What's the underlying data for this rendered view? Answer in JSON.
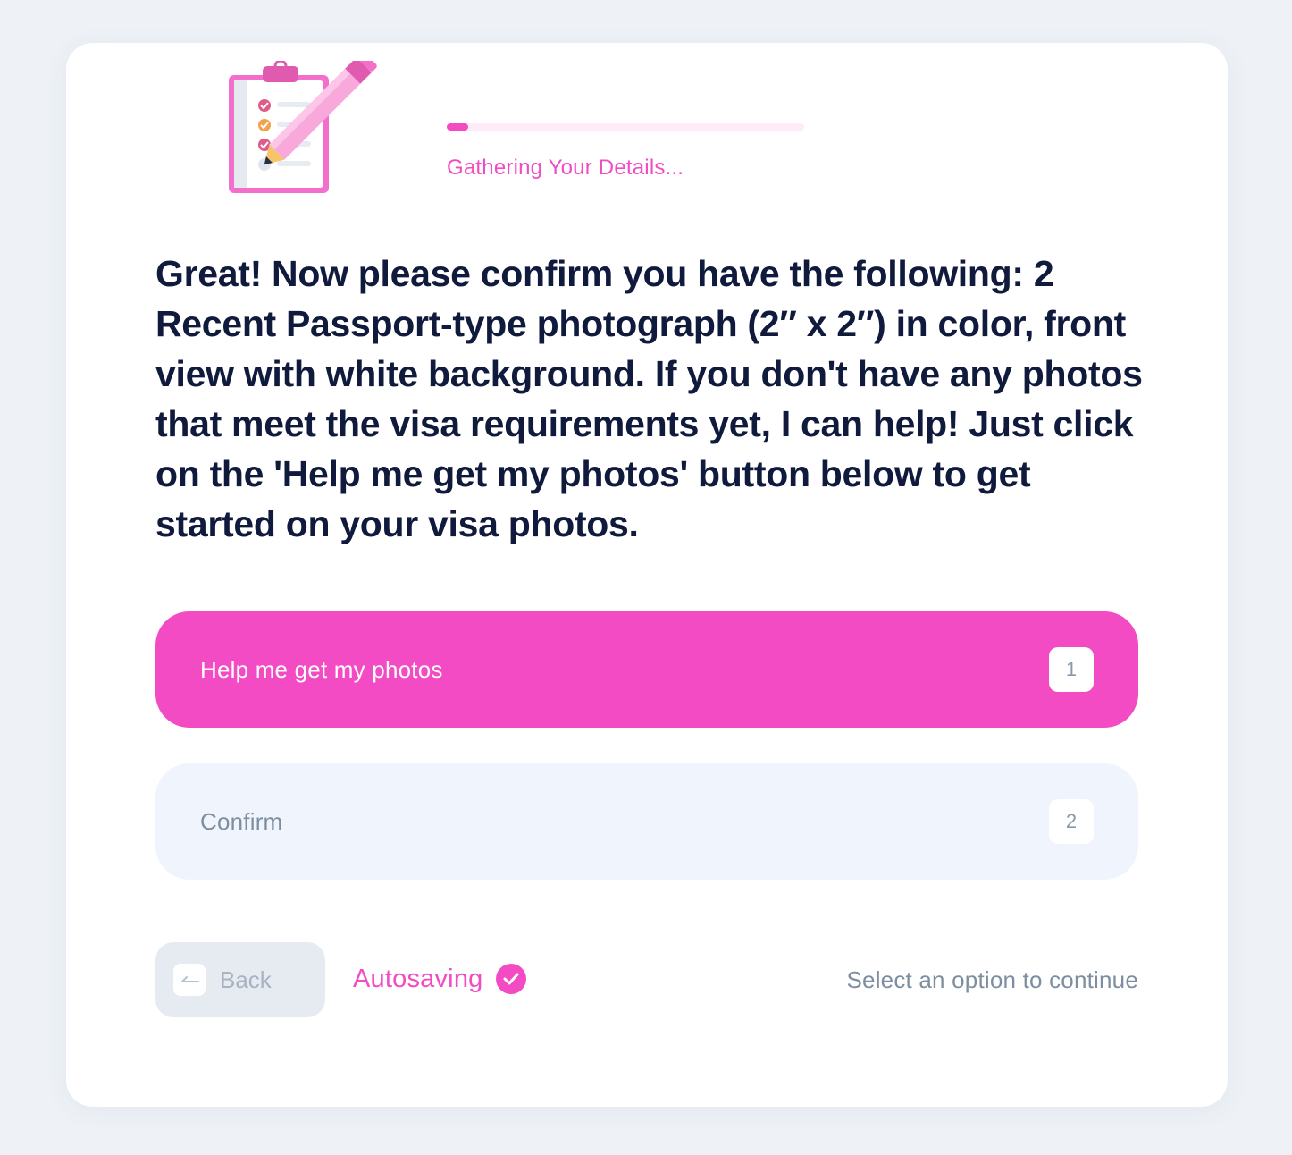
{
  "header": {
    "progress_label": "Gathering Your Details...",
    "progress_fraction": 0.06,
    "illustration_icon": "clipboard-pencil-icon"
  },
  "question": {
    "text": "Great! Now please confirm you have the following: 2 Recent Passport-type photograph (2″ x 2″) in color, front view with white background. If you don't have any photos that meet the visa requirements yet, I can help! Just click on the 'Help me get my photos' button below to get started on your visa photos."
  },
  "options": [
    {
      "label": "Help me get my photos",
      "key": "1"
    },
    {
      "label": "Confirm",
      "key": "2"
    }
  ],
  "footer": {
    "back_label": "Back",
    "back_icon": "arrow-left-icon",
    "autosave_label": "Autosaving",
    "autosave_icon": "check-circle-icon",
    "hint": "Select an option to continue"
  },
  "colors": {
    "accent": "#f24bc3",
    "heading": "#101a3c",
    "muted": "#7d8ea0",
    "page_background": "#eef2f7",
    "secondary_option_background": "#f0f5fd"
  }
}
